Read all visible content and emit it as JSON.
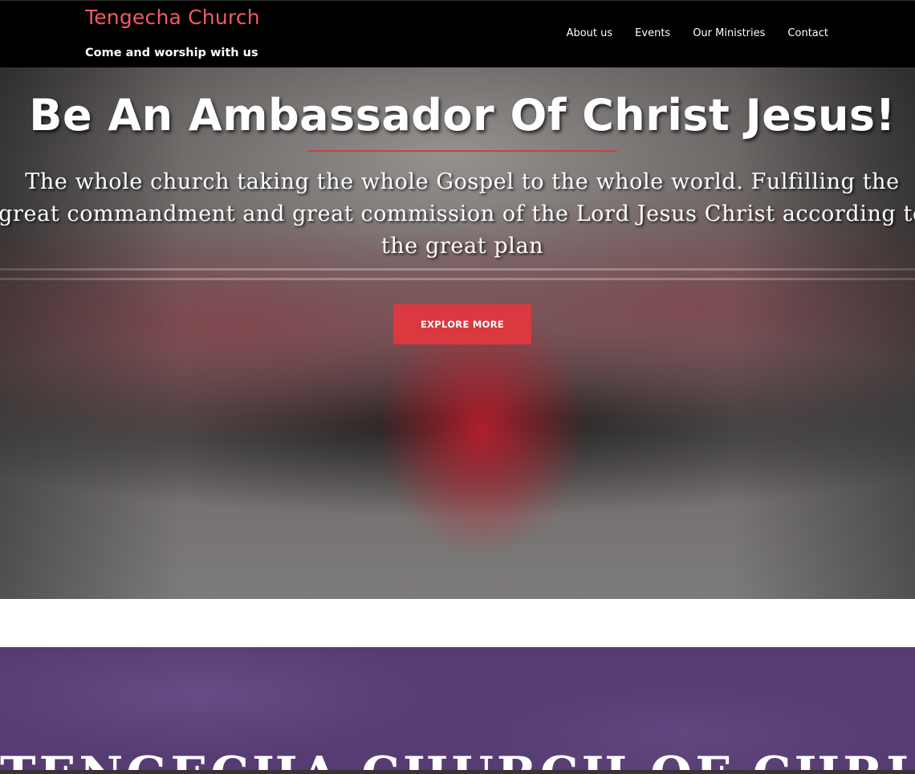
{
  "header": {
    "brand_title": "Tengecha Church",
    "tagline": "Come and worship with us",
    "nav": [
      "About us",
      "Events",
      "Our Ministries",
      "Contact"
    ]
  },
  "hero": {
    "heading": "Be An Ambassador Of Christ Jesus!",
    "subtitle": "The whole church taking the whole Gospel to the whole world. Fulfilling the great commandment and great commission of the Lord Jesus Christ according to the great plan",
    "button_label": "EXPLORE MORE"
  },
  "section": {
    "heading": "TENGECHA CHURCH OF CHRIST"
  },
  "colors": {
    "brand": "#f05a67",
    "accent": "#d9393f",
    "purple": "#563c72"
  }
}
